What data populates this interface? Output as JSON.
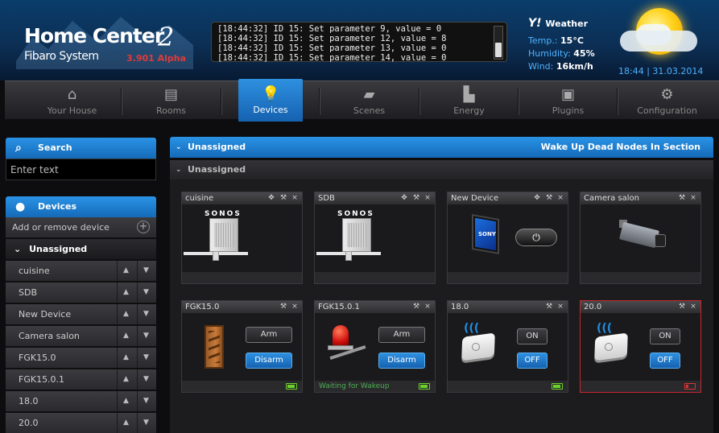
{
  "header": {
    "logo_title": "Home Center",
    "logo_two": "2",
    "logo_sub": "Fibaro System",
    "version": "3.901 Alpha",
    "log_lines": [
      "[18:44:32] ID 15: Set parameter 9, value = 0",
      "[18:44:32] ID 15: Set parameter 12, value = 8",
      "[18:44:32] ID 15: Set parameter 13, value = 0",
      "[18:44:32] ID 15: Set parameter 14, value = 0"
    ],
    "weather": {
      "brand": "Y!",
      "label": "Weather",
      "temp_label": "Temp.:",
      "temp_value": "15°C",
      "humidity_label": "Humidity:",
      "humidity_value": "45%",
      "wind_label": "Wind:",
      "wind_value": "16km/h"
    },
    "datetime": "18:44 | 31.03.2014"
  },
  "nav": {
    "items": [
      {
        "label": "Your House",
        "icon": "house-icon"
      },
      {
        "label": "Rooms",
        "icon": "rooms-icon"
      },
      {
        "label": "Devices",
        "icon": "lightbulb-icon"
      },
      {
        "label": "Scenes",
        "icon": "clapperboard-icon"
      },
      {
        "label": "Energy",
        "icon": "energy-chart-icon"
      },
      {
        "label": "Plugins",
        "icon": "plugin-box-icon"
      },
      {
        "label": "Configuration",
        "icon": "gears-icon"
      }
    ]
  },
  "sidebar": {
    "search_label": "Search",
    "search_placeholder": "Enter text",
    "devices_label": "Devices",
    "add_remove_label": "Add or remove device",
    "section_label": "Unassigned",
    "items": [
      "cuisine",
      "SDB",
      "New Device",
      "Camera salon",
      "FGK15.0",
      "FGK15.0.1",
      "18.0",
      "20.0"
    ]
  },
  "main": {
    "head_title": "Unassigned",
    "head_action": "Wake Up Dead Nodes In Section",
    "sub_title": "Unassigned",
    "cards": [
      {
        "title": "cuisine",
        "brand": "SONOS"
      },
      {
        "title": "SDB",
        "brand": "SONOS"
      },
      {
        "title": "New Device",
        "brand": "SONY"
      },
      {
        "title": "Camera salon"
      },
      {
        "title": "FGK15.0",
        "btn_a": "Arm",
        "btn_b": "Disarm"
      },
      {
        "title": "FGK15.0.1",
        "btn_a": "Arm",
        "btn_b": "Disarm",
        "footer": "Waiting for Wakeup"
      },
      {
        "title": "18.0",
        "btn_a": "ON",
        "btn_b": "OFF"
      },
      {
        "title": "20.0",
        "btn_a": "ON",
        "btn_b": "OFF"
      }
    ]
  },
  "colors": {
    "accent": "#1f7fd6",
    "error_border": "#c8262b",
    "battery_ok": "#6bd12a",
    "battery_low": "#dd3333"
  }
}
